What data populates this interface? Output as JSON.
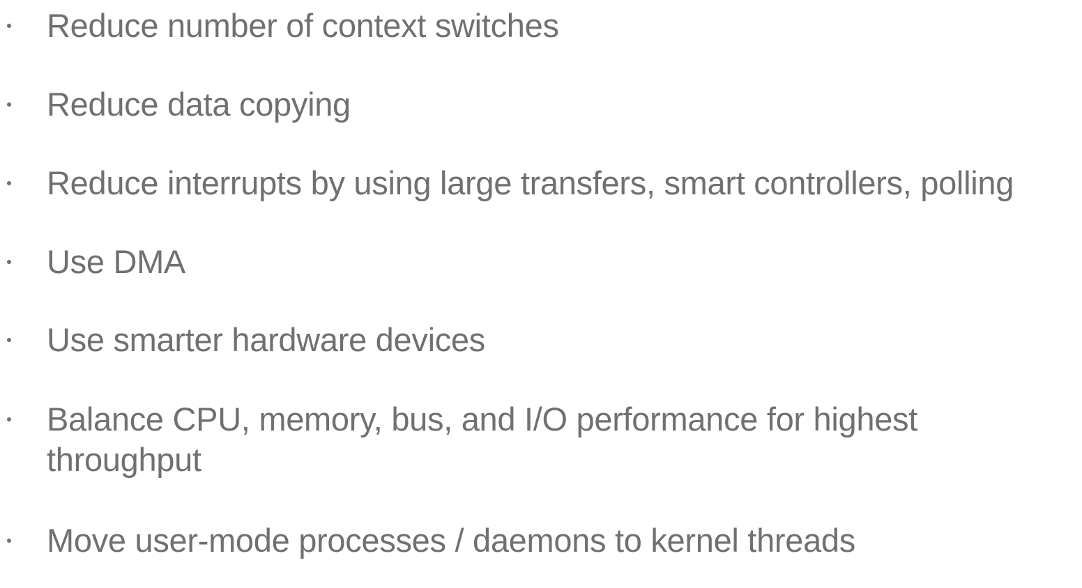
{
  "slide": {
    "bullets": [
      {
        "text": "Reduce number of context switches"
      },
      {
        "text": "Reduce data copying"
      },
      {
        "text": "Reduce interrupts by using large transfers, smart controllers, polling"
      },
      {
        "text": "Use DMA"
      },
      {
        "text": "Use smarter hardware devices"
      },
      {
        "text": "Balance CPU, memory, bus, and I/O performance for highest\nthroughput"
      },
      {
        "text": "Move user-mode processes / daemons to kernel threads"
      }
    ]
  }
}
